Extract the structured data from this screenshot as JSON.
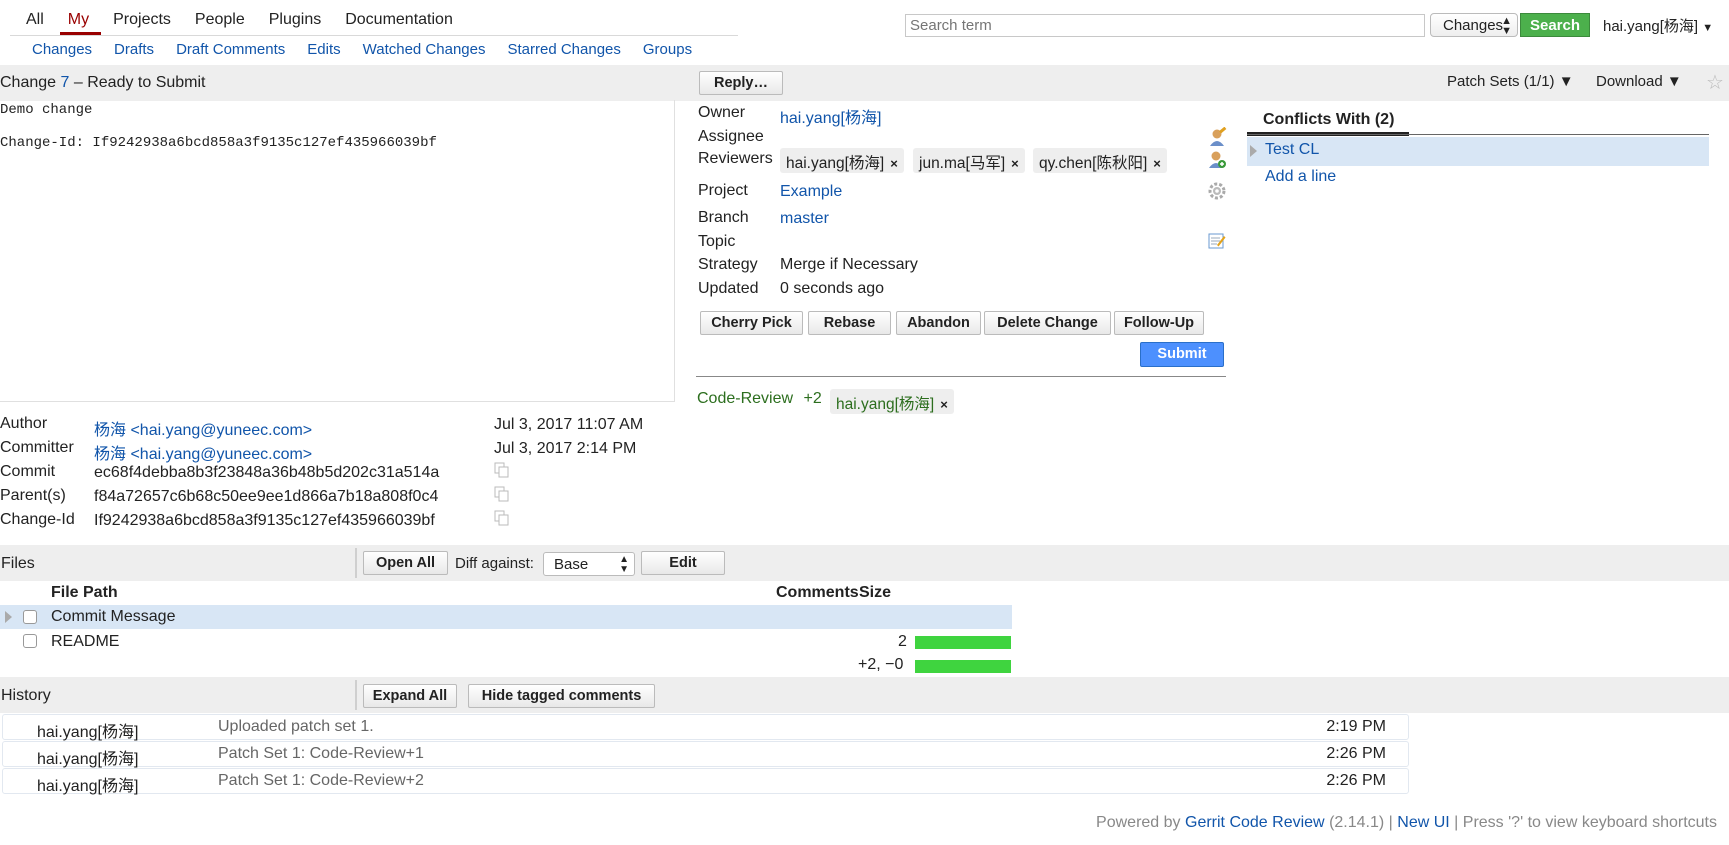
{
  "topnav": {
    "tabs": [
      "All",
      "My",
      "Projects",
      "People",
      "Plugins",
      "Documentation"
    ],
    "active": "My",
    "subtabs": [
      "Changes",
      "Drafts",
      "Draft Comments",
      "Edits",
      "Watched Changes",
      "Starred Changes",
      "Groups"
    ]
  },
  "search": {
    "placeholder": "Search term",
    "scope": "Changes",
    "button": "Search"
  },
  "user": "hai.yang[杨海]",
  "change": {
    "prefix": "Change",
    "number": "7",
    "dash": "–",
    "status": "Ready to Submit",
    "reply": "Reply…",
    "patch_sets": "Patch Sets (1/1) ▼",
    "download": "Download ▼",
    "commit_lines": [
      "Demo change",
      "Change-Id: If9242938a6bcd858a3f9135c127ef435966039bf"
    ]
  },
  "info": {
    "owner_label": "Owner",
    "owner": "hai.yang[杨海]",
    "assignee_label": "Assignee",
    "reviewers_label": "Reviewers",
    "reviewers": [
      "hai.yang[杨海]",
      "jun.ma[马军]",
      "qy.chen[陈秋阳]"
    ],
    "project_label": "Project",
    "project": "Example",
    "branch_label": "Branch",
    "branch": "master",
    "topic_label": "Topic",
    "strategy_label": "Strategy",
    "strategy": "Merge if Necessary",
    "updated_label": "Updated",
    "updated": "0 seconds ago"
  },
  "actions": [
    "Cherry Pick",
    "Rebase",
    "Abandon",
    "Delete Change",
    "Follow-Up"
  ],
  "submit": "Submit",
  "review": {
    "label": "Code-Review",
    "score": "+2",
    "voter": "hai.yang[杨海]"
  },
  "conflicts": {
    "title": "Conflicts With (2)",
    "items": [
      "Test CL",
      "Add a line"
    ]
  },
  "meta": {
    "author_label": "Author",
    "author": "杨海 <hai.yang@yuneec.com>",
    "author_date": "Jul 3, 2017 11:07 AM",
    "committer_label": "Committer",
    "committer": "杨海 <hai.yang@yuneec.com>",
    "committer_date": "Jul 3, 2017 2:14 PM",
    "commit_label": "Commit",
    "commit": "ec68f4debba8b3f23848a36b48b5d202c31a514a",
    "parent_label": "Parent(s)",
    "parent": "f84a72657c6b68c50ee9ee1d866a7b18a808f0c4",
    "changeid_label": "Change-Id",
    "changeid": "If9242938a6bcd858a3f9135c127ef435966039bf"
  },
  "files": {
    "title": "Files",
    "open_all": "Open All",
    "diff_label": "Diff against:",
    "diff_base": "Base",
    "edit": "Edit",
    "col_path": "File Path",
    "col_comments": "Comments",
    "col_size": "Size",
    "rows": [
      {
        "path": "Commit Message",
        "comments": "",
        "size_fraction": 0
      },
      {
        "path": "README",
        "comments": "2",
        "size_fraction": 1.0
      }
    ],
    "total": "+2, −0",
    "total_fraction": 1.0,
    "bar_color": "#3fd43f"
  },
  "history": {
    "title": "History",
    "expand_all": "Expand All",
    "hide_tagged": "Hide tagged comments",
    "rows": [
      {
        "name": "hai.yang[杨海]",
        "msg": "Uploaded patch set 1.",
        "time": "2:19 PM"
      },
      {
        "name": "hai.yang[杨海]",
        "msg": "Patch Set 1: Code-Review+1",
        "time": "2:26 PM"
      },
      {
        "name": "hai.yang[杨海]",
        "msg": "Patch Set 1: Code-Review+2",
        "time": "2:26 PM"
      }
    ]
  },
  "footer": {
    "powered": "Powered by",
    "gerrit": "Gerrit Code Review",
    "version": "(2.14.1)",
    "sep": "|",
    "newui": "New UI",
    "shortcut": "Press '?' to view keyboard shortcuts"
  },
  "colors": {
    "accent": "#1155aa",
    "active_tab": "#990000",
    "search_button": "#4cb04c",
    "submit_button": "#4d90fe",
    "review_green": "#2c6e1e",
    "highlight_row": "#d8e6f5"
  }
}
